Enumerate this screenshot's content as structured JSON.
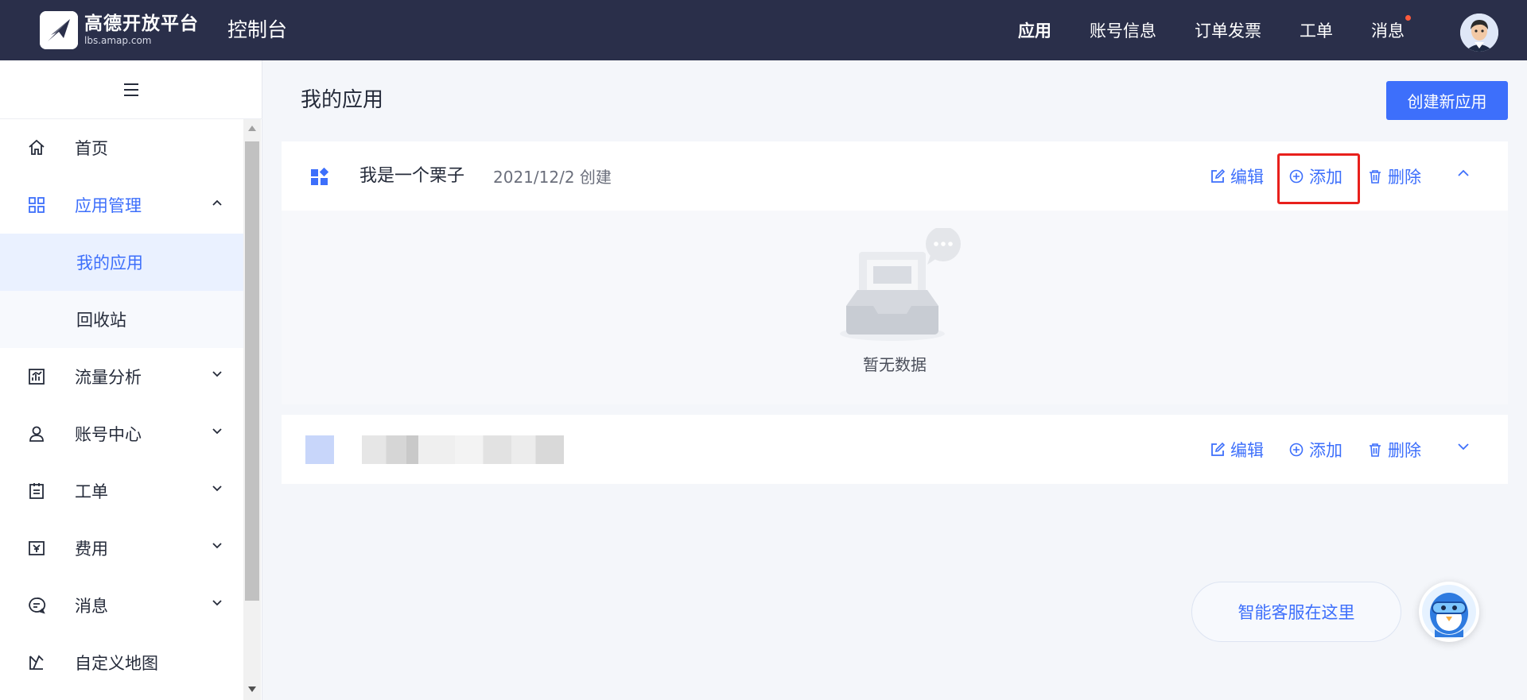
{
  "topbar": {
    "logo_main": "高德开放平台",
    "logo_sub": "lbs.amap.com",
    "console_title": "控制台",
    "nav": [
      {
        "label": "应用",
        "active": true
      },
      {
        "label": "账号信息"
      },
      {
        "label": "订单发票"
      },
      {
        "label": "工单"
      },
      {
        "label": "消息",
        "has_dot": true
      }
    ]
  },
  "sidebar": {
    "items": [
      {
        "label": "首页",
        "icon": "home-icon"
      },
      {
        "label": "应用管理",
        "icon": "grid-icon",
        "expanded": true,
        "children": [
          {
            "label": "我的应用",
            "active": true
          },
          {
            "label": "回收站"
          }
        ]
      },
      {
        "label": "流量分析",
        "icon": "chart-icon"
      },
      {
        "label": "账号中心",
        "icon": "user-icon"
      },
      {
        "label": "工单",
        "icon": "ticket-icon"
      },
      {
        "label": "费用",
        "icon": "yen-icon"
      },
      {
        "label": "消息",
        "icon": "message-icon"
      },
      {
        "label": "自定义地图",
        "icon": "map-icon"
      }
    ]
  },
  "main": {
    "title": "我的应用",
    "create_button": "创建新应用",
    "apps": [
      {
        "name": "我是一个栗子",
        "date": "2021/12/2 创建",
        "expanded": true,
        "empty_text": "暂无数据"
      },
      {
        "name": "",
        "date": "",
        "expanded": false,
        "blurred": true
      }
    ],
    "actions": {
      "edit": "编辑",
      "add": "添加",
      "delete": "删除"
    }
  },
  "assistant": {
    "label": "智能客服在这里"
  },
  "colors": {
    "accent": "#3d6ffb",
    "topbar": "#2a2f4a",
    "highlight": "#e8201c"
  }
}
